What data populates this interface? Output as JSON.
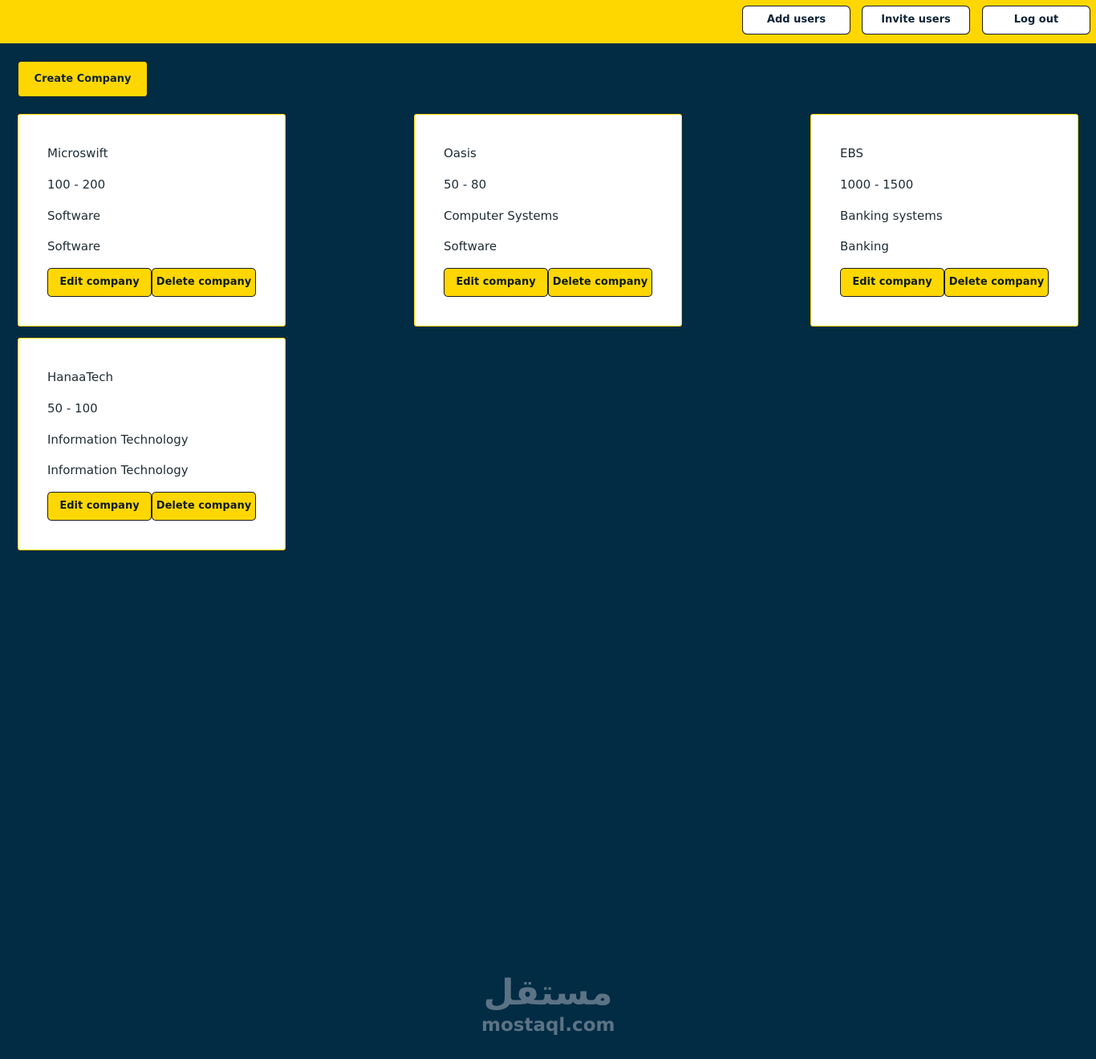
{
  "header": {
    "background_color": "#ffd700",
    "buttons": {
      "add_users": "Add users",
      "invite_users": "Invite users",
      "log_out": "Log out"
    }
  },
  "toolbar": {
    "create_company_label": "Create Company"
  },
  "companies": [
    {
      "name": "Microswift",
      "size": "100 - 200",
      "field": "Software",
      "category": "Software",
      "edit_label": "Edit company",
      "delete_label": "Delete company"
    },
    {
      "name": "Oasis",
      "size": "50 - 80",
      "field": "Computer Systems",
      "category": "Software",
      "edit_label": "Edit company",
      "delete_label": "Delete company"
    },
    {
      "name": "EBS",
      "size": "1000 - 1500",
      "field": "Banking systems",
      "category": "Banking",
      "edit_label": "Edit company",
      "delete_label": "Delete company"
    },
    {
      "name": "HanaaTech",
      "size": "50 - 100",
      "field": "Information Technology",
      "category": "Information Technology",
      "edit_label": "Edit company",
      "delete_label": "Delete company"
    }
  ],
  "watermark": {
    "arabic": "مستقل",
    "latin": "mostaql.com"
  },
  "colors": {
    "page_background": "#022b44",
    "accent": "#ffd700",
    "card_background": "#ffffff"
  }
}
